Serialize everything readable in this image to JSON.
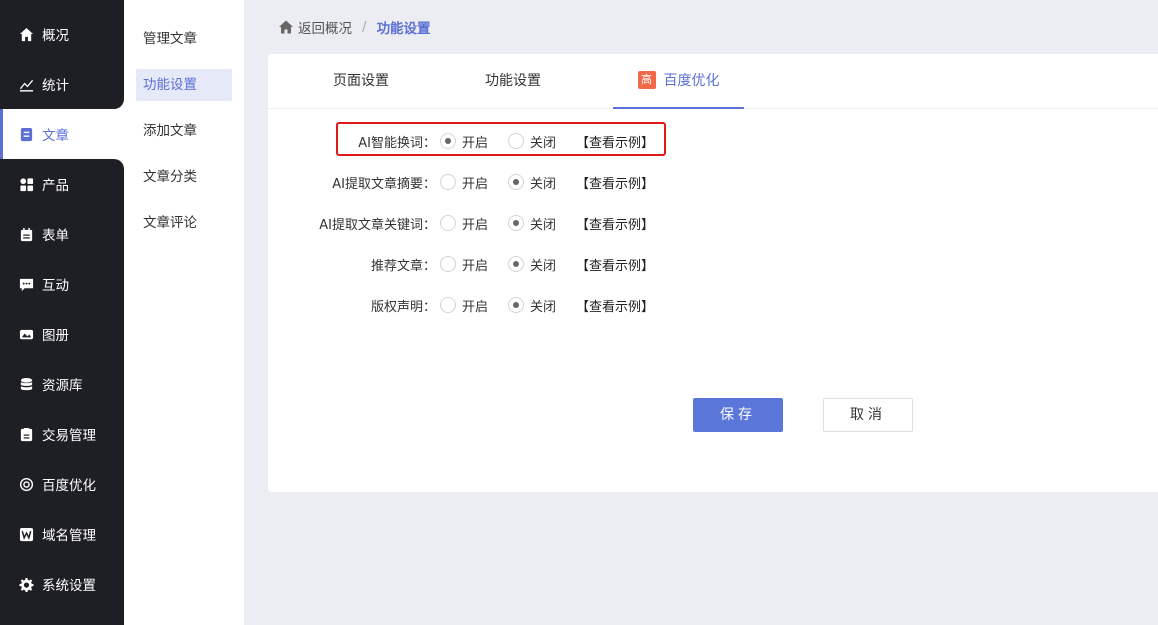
{
  "sidebar": {
    "items": [
      {
        "label": "概况",
        "icon": "home-icon"
      },
      {
        "label": "统计",
        "icon": "chart-icon"
      },
      {
        "label": "文章",
        "icon": "article-icon"
      },
      {
        "label": "产品",
        "icon": "grid-icon"
      },
      {
        "label": "表单",
        "icon": "calendar-icon"
      },
      {
        "label": "互动",
        "icon": "chat-icon"
      },
      {
        "label": "图册",
        "icon": "album-icon"
      },
      {
        "label": "资源库",
        "icon": "database-icon"
      },
      {
        "label": "交易管理",
        "icon": "clipboard-icon"
      },
      {
        "label": "百度优化",
        "icon": "target-icon"
      },
      {
        "label": "域名管理",
        "icon": "w-icon"
      },
      {
        "label": "系统设置",
        "icon": "gear-icon"
      }
    ]
  },
  "submenu": {
    "items": [
      {
        "label": "管理文章"
      },
      {
        "label": "功能设置"
      },
      {
        "label": "添加文章"
      },
      {
        "label": "文章分类"
      },
      {
        "label": "文章评论"
      }
    ]
  },
  "breadcrumb": {
    "back": "返回概况",
    "separator": "/",
    "current": "功能设置"
  },
  "tabs": [
    {
      "label": "页面设置"
    },
    {
      "label": "功能设置"
    },
    {
      "label": "百度优化",
      "badge": "高"
    }
  ],
  "settings": [
    {
      "label": "AI智能换词：",
      "on": "开启",
      "off": "关闭",
      "example": "【查看示例】",
      "value": "on"
    },
    {
      "label": "AI提取文章摘要：",
      "on": "开启",
      "off": "关闭",
      "example": "【查看示例】",
      "value": "off"
    },
    {
      "label": "AI提取文章关键词：",
      "on": "开启",
      "off": "关闭",
      "example": "【查看示例】",
      "value": "off"
    },
    {
      "label": "推荐文章：",
      "on": "开启",
      "off": "关闭",
      "example": "【查看示例】",
      "value": "off"
    },
    {
      "label": "版权声明：",
      "on": "开启",
      "off": "关闭",
      "example": "【查看示例】",
      "value": "off"
    }
  ],
  "actions": {
    "save": "保存",
    "cancel": "取消"
  },
  "colors": {
    "sidebar_bg": "#1e1f24",
    "accent": "#5b6fd4",
    "highlight_border": "#e0191a",
    "badge": "#f06a4a"
  }
}
